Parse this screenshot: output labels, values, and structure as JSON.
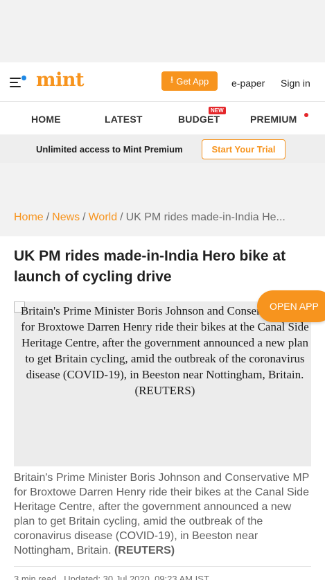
{
  "header": {
    "logo": "mint",
    "get_app_label": "Get App",
    "epaper_label": "e-paper",
    "signin_label": "Sign in"
  },
  "nav": {
    "items": [
      "HOME",
      "LATEST",
      "BUDGET",
      "PREMIUM"
    ],
    "budget_badge": "NEW"
  },
  "promo": {
    "text": "Unlimited access to Mint Premium",
    "cta": "Start Your Trial"
  },
  "breadcrumb": {
    "items": [
      "Home",
      "News",
      "World"
    ],
    "current": "UK PM rides made-in-India He..."
  },
  "article": {
    "headline": "UK PM rides made-in-India Hero bike at launch of cycling drive",
    "image_alt": "Britain's Prime Minister Boris Johnson and Conservative MP for Broxtowe Darren Henry ride their bikes at the Canal Side Heritage Centre, after the government announced a new plan to get Britain cycling, amid the outbreak of the coronavirus disease (COVID-19), in Beeston near Nottingham, Britain. (REUTERS)",
    "caption_text": "Britain's Prime Minister Boris Johnson and Conservative MP for Broxtowe Darren Henry ride their bikes at the Canal Side Heritage Centre, after the government announced a new plan to get Britain cycling, amid the outbreak of the coronavirus disease (COVID-19), in Beeston near Nottingham, Britain. ",
    "caption_credit": "(REUTERS)",
    "read_time": "3 min read",
    "updated": ". Updated: 30 Jul 2020, 09:23 AM IST"
  },
  "floating": {
    "open_app_label": "OPEN APP"
  },
  "colors": {
    "brand_orange": "#f7941e",
    "badge_red": "#e4262a"
  }
}
